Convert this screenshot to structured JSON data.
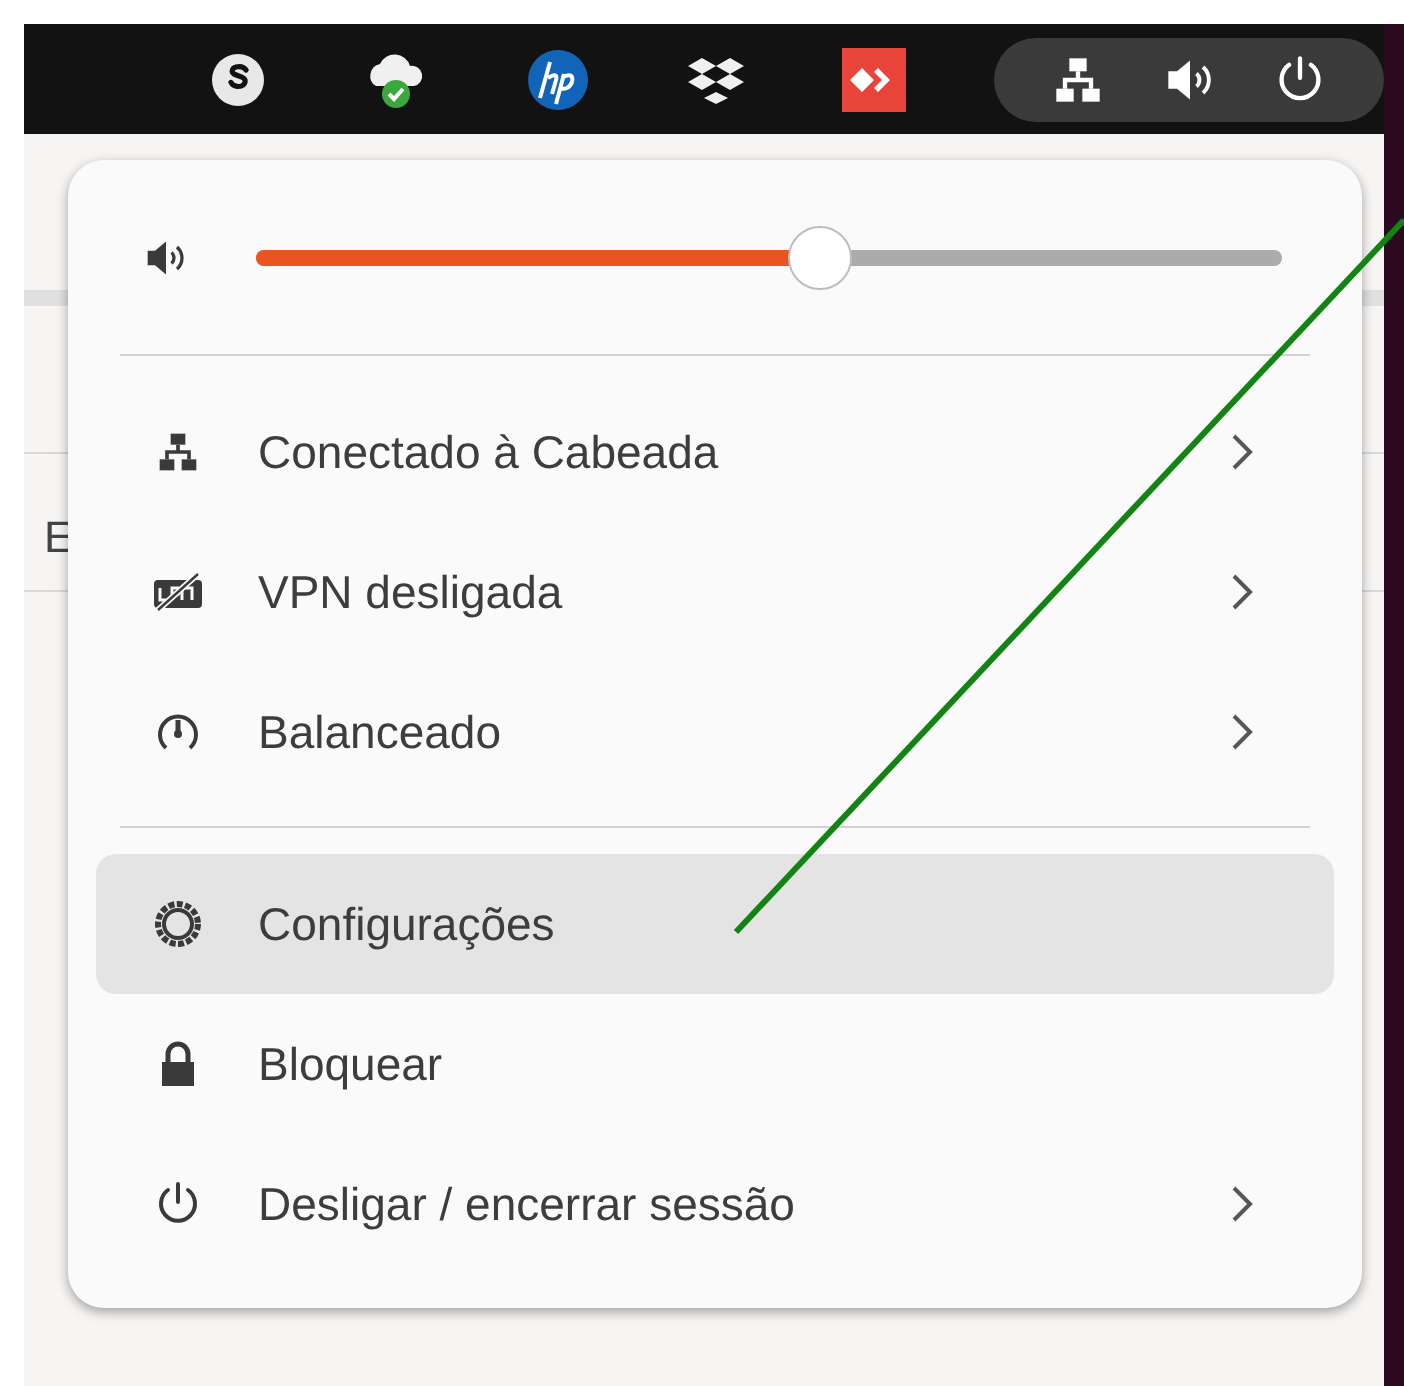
{
  "top_bar": {
    "tray_icons": [
      {
        "kind": "skype"
      },
      {
        "kind": "cloud"
      },
      {
        "kind": "hp"
      },
      {
        "kind": "dropbox"
      },
      {
        "kind": "anydesk"
      }
    ],
    "status_icons": [
      {
        "kind": "network"
      },
      {
        "kind": "volume"
      },
      {
        "kind": "power"
      }
    ]
  },
  "background_window": {
    "text": "E"
  },
  "menu": {
    "volume": {
      "level": 0.55
    },
    "sections": [
      [
        {
          "kind": "network",
          "label": "Conectado à Cabeada",
          "submenu": true,
          "selected": false
        },
        {
          "kind": "vpn",
          "label": "VPN desligada",
          "submenu": true,
          "selected": false
        },
        {
          "kind": "power-mode",
          "label": "Balanceado",
          "submenu": true,
          "selected": false
        }
      ],
      [
        {
          "kind": "settings",
          "label": "Configurações",
          "submenu": false,
          "selected": true
        },
        {
          "kind": "lock",
          "label": "Bloquear",
          "submenu": false,
          "selected": false
        },
        {
          "kind": "power",
          "label": "Desligar / encerrar sessão",
          "submenu": true,
          "selected": false
        }
      ]
    ]
  }
}
